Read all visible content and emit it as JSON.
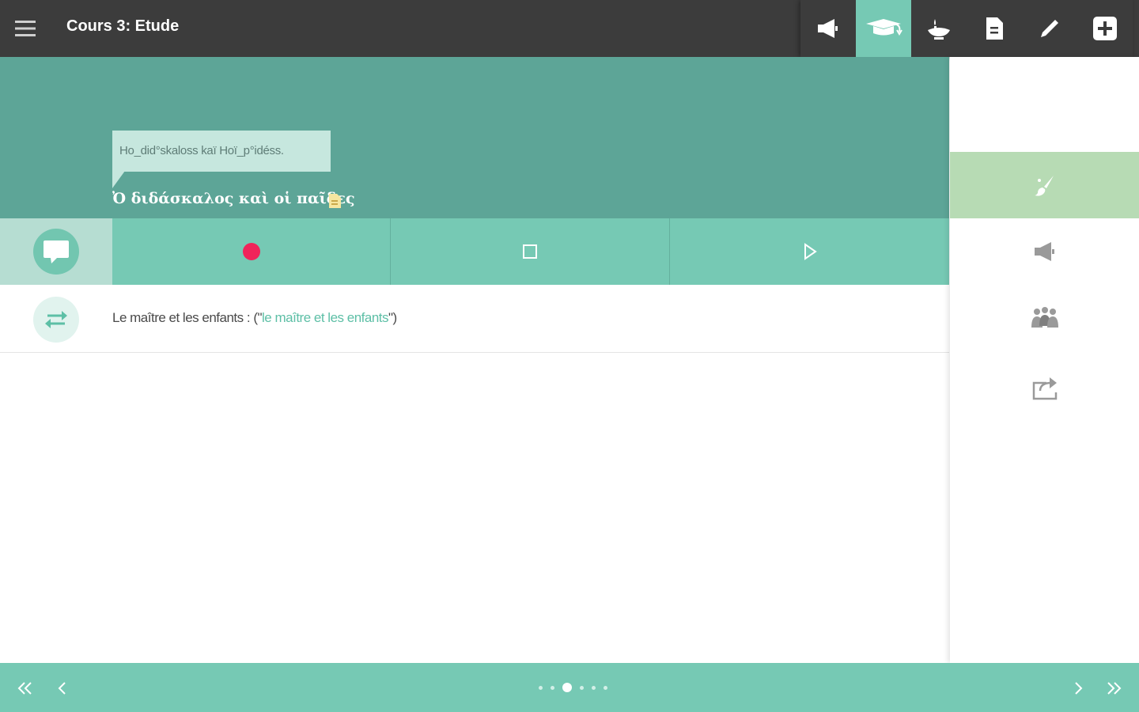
{
  "header": {
    "title": "Cours 3: Etude"
  },
  "toolbar": {
    "items": [
      {
        "icon": "megaphone-icon",
        "active": false
      },
      {
        "icon": "graduation-cap-icon",
        "active": true
      },
      {
        "icon": "oil-lamp-icon",
        "active": false
      },
      {
        "icon": "document-icon",
        "active": false
      },
      {
        "icon": "pencil-icon",
        "active": false
      },
      {
        "icon": "add-box-icon",
        "active": false
      }
    ]
  },
  "lesson": {
    "transliteration": "Ho_did°skaloss kaï Hoï_p°idéss.",
    "greek_title": "Ὀ διδάσκαλος καὶ οἱ παῖδες"
  },
  "translation": {
    "text": "Le maître et les enfants : (\"",
    "highlight": "le maître et les enfants",
    "suffix": "\")"
  },
  "sidebar": {
    "items": [
      {
        "icon": "brush-icon",
        "active": true
      },
      {
        "icon": "speaker-icon",
        "active": false
      },
      {
        "icon": "people-icon",
        "active": false
      },
      {
        "icon": "share-icon",
        "active": false
      }
    ]
  },
  "pagination": {
    "total": 6,
    "current": 2
  },
  "colors": {
    "topbar": "#3c3c3c",
    "header_panel": "#5da597",
    "accent": "#76c9b4",
    "record": "#f0245a",
    "sidebar_active": "#b7dbb4"
  }
}
